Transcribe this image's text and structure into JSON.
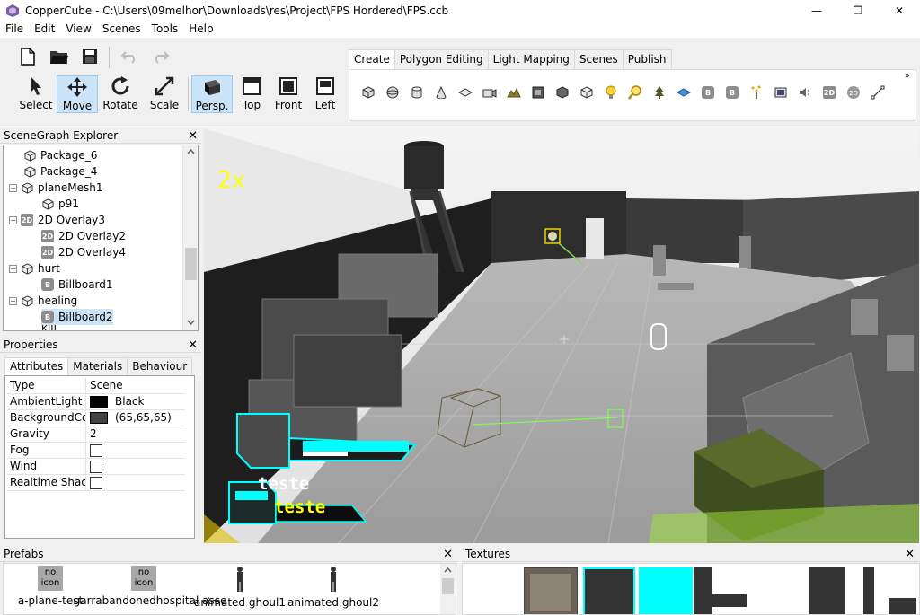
{
  "window": {
    "title": "CopperCube - C:\\Users\\09melhor\\Downloads\\res\\Project\\FPS Hordered\\FPS.ccb",
    "minimize": "—",
    "maximize": "❐",
    "close": "✕"
  },
  "menu": {
    "items": [
      "File",
      "Edit",
      "View",
      "Scenes",
      "Tools",
      "Help"
    ]
  },
  "toolbar": {
    "tools": [
      {
        "label": "Select"
      },
      {
        "label": "Move"
      },
      {
        "label": "Rotate"
      },
      {
        "label": "Scale"
      },
      {
        "label": "Persp."
      },
      {
        "label": "Top"
      },
      {
        "label": "Front"
      },
      {
        "label": "Left"
      }
    ]
  },
  "create_tabs": {
    "tabs": [
      "Create",
      "Polygon Editing",
      "Light Mapping",
      "Scenes",
      "Publish"
    ],
    "more": "»",
    "icons": [
      "cube",
      "sphere",
      "cylinder",
      "cone",
      "plane",
      "camera",
      "terrain",
      "skybox",
      "mesh",
      "box",
      "light",
      "magnifier",
      "tree",
      "water",
      "billboard-b",
      "billboard-b2",
      "particles",
      "image",
      "sound",
      "2d-overlay",
      "2d-circle",
      "path"
    ]
  },
  "scenegraph": {
    "title": "SceneGraph Explorer",
    "close": "✕",
    "rows": [
      {
        "label": "Package_6",
        "icon": "mesh"
      },
      {
        "label": "Package_4",
        "icon": "mesh"
      },
      {
        "label": "planeMesh1",
        "icon": "mesh",
        "expander": "−"
      },
      {
        "label": "p91",
        "icon": "mesh"
      },
      {
        "label": "2D Overlay3",
        "icon": "2d",
        "expander": "−"
      },
      {
        "label": "2D Overlay2",
        "icon": "2d"
      },
      {
        "label": "2D Overlay4",
        "icon": "2d"
      },
      {
        "label": "hurt",
        "icon": "mesh",
        "expander": "−"
      },
      {
        "label": "Billboard1",
        "icon": "b"
      },
      {
        "label": "healing",
        "icon": "mesh",
        "expander": "−"
      },
      {
        "label": "Billboard2",
        "icon": "b"
      },
      {
        "label": "kill",
        "icon": "mesh"
      }
    ],
    "badge_2d": "2D",
    "badge_b": "B"
  },
  "properties": {
    "title": "Properties",
    "close": "✕",
    "tabs": [
      "Attributes",
      "Materials",
      "Behaviour"
    ],
    "rows": [
      {
        "key": "Type",
        "value": "Scene"
      },
      {
        "key": "AmbientLight",
        "value": "Black",
        "color": "#000000"
      },
      {
        "key": "BackgroundColor",
        "value": "(65,65,65)",
        "color": "#414141"
      },
      {
        "key": "Gravity",
        "value": "2"
      },
      {
        "key": "Fog",
        "value": "",
        "checkbox": true
      },
      {
        "key": "Wind",
        "value": "",
        "checkbox": true
      },
      {
        "key": "Realtime Shadows",
        "value": "",
        "checkbox": true
      }
    ]
  },
  "viewport": {
    "overlay_text_2x": "2x",
    "hud_text_1": "teste",
    "hud_text_2": "teste"
  },
  "prefabs": {
    "title": "Prefabs",
    "close": "✕",
    "noicon": "no icon",
    "items": [
      "a-plane-test",
      "garrabandonedhospital asse",
      "animated ghoul1",
      "animated ghoul2"
    ]
  },
  "textures": {
    "title": "Textures",
    "close": "✕"
  },
  "colors": {
    "hud_cyan": "#00ffff",
    "hud_yellow": "#ffff00",
    "accent_select": "#cce4f7"
  }
}
